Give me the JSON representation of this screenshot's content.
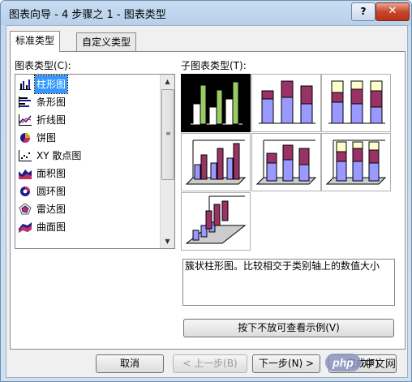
{
  "window": {
    "title": "图表向导 - 4 步骤之 1 - 图表类型",
    "help_label": "?",
    "close_label": "✕"
  },
  "tabs": [
    {
      "label": "标准类型",
      "active": true
    },
    {
      "label": "自定义类型",
      "active": false
    }
  ],
  "chart_type_list": {
    "label": "图表类型(C):",
    "items": [
      {
        "label": "柱形图",
        "icon": "column-chart-icon",
        "selected": true
      },
      {
        "label": "条形图",
        "icon": "bar-chart-icon"
      },
      {
        "label": "折线图",
        "icon": "line-chart-icon"
      },
      {
        "label": "饼图",
        "icon": "pie-chart-icon"
      },
      {
        "label": "XY 散点图",
        "icon": "scatter-chart-icon"
      },
      {
        "label": "面积图",
        "icon": "area-chart-icon"
      },
      {
        "label": "圆环图",
        "icon": "doughnut-chart-icon"
      },
      {
        "label": "雷达图",
        "icon": "radar-chart-icon"
      },
      {
        "label": "曲面图",
        "icon": "surface-chart-icon"
      }
    ]
  },
  "subtype": {
    "label": "子图表类型(T):",
    "variants": [
      {
        "name": "clustered-column",
        "selected": true
      },
      {
        "name": "stacked-column"
      },
      {
        "name": "100-stacked-column"
      },
      {
        "name": "3d-clustered-column"
      },
      {
        "name": "3d-stacked-column"
      },
      {
        "name": "3d-100-stacked-column"
      },
      {
        "name": "3d-column"
      }
    ],
    "description": "簇状柱形图。比较相交于类别轴上的数值大小"
  },
  "preview_button_label": "按下不放可查看示例(V)",
  "footer": {
    "cancel_label": "取消",
    "back_label": "< 上一步(B)",
    "next_label": "下一步(N) >",
    "finish_label": "完成(F)"
  },
  "watermark": {
    "text": "中文网"
  },
  "colors": {
    "selection": "#3399ff",
    "bar_blue": "#9999ff",
    "bar_plum": "#993366",
    "bar_cream": "#ffffcc",
    "bar_green": "#99cc66"
  }
}
